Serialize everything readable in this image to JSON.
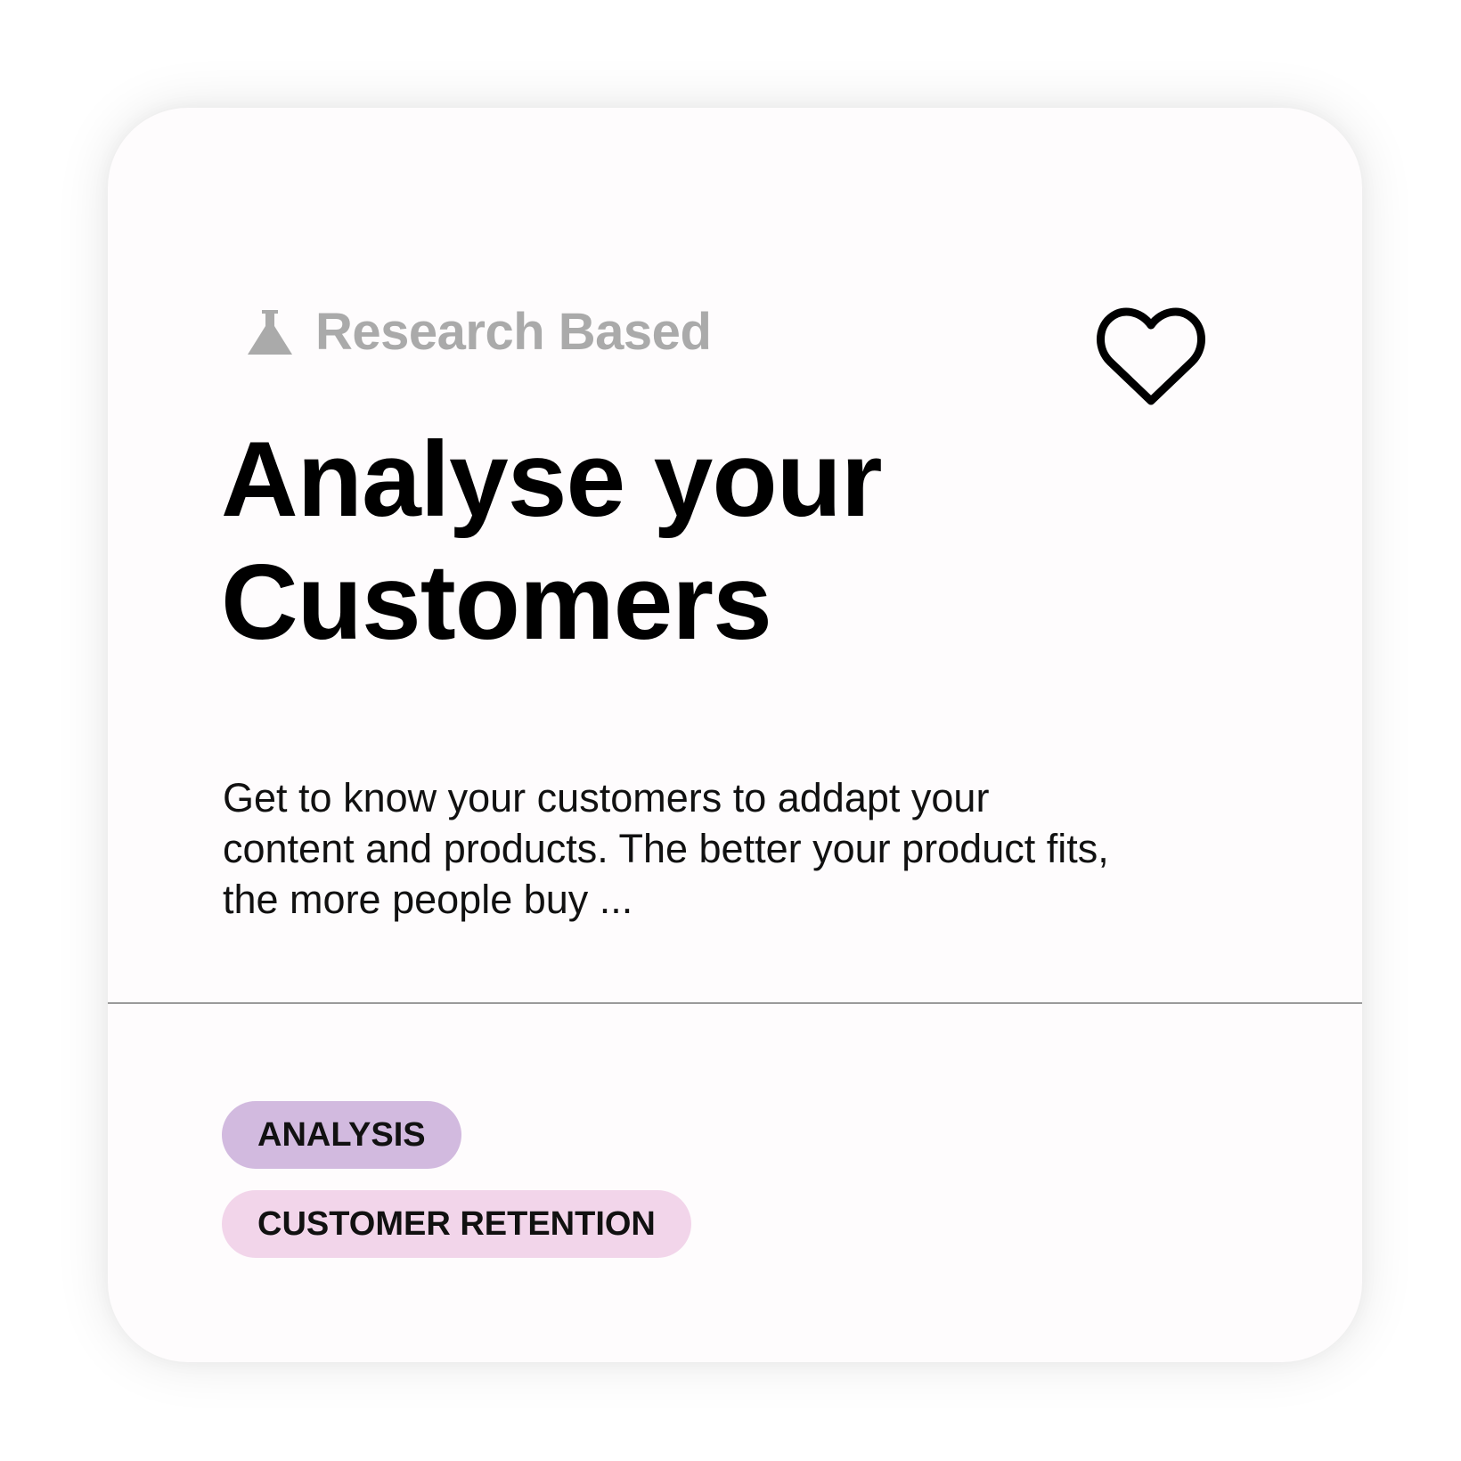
{
  "card": {
    "badge": {
      "icon": "flask-icon",
      "label": "Research Based",
      "color": "#aaaaaa"
    },
    "favorite": {
      "icon": "heart-outline-icon"
    },
    "title": "Analyse your Customers",
    "description": "Get to know your customers to addapt your content and products. The better your product fits, the more people buy ...",
    "tags": [
      {
        "label": "ANALYSIS",
        "color": "#d2badf"
      },
      {
        "label": "CUSTOMER RETENTION",
        "color": "#f2d5ea"
      }
    ]
  }
}
